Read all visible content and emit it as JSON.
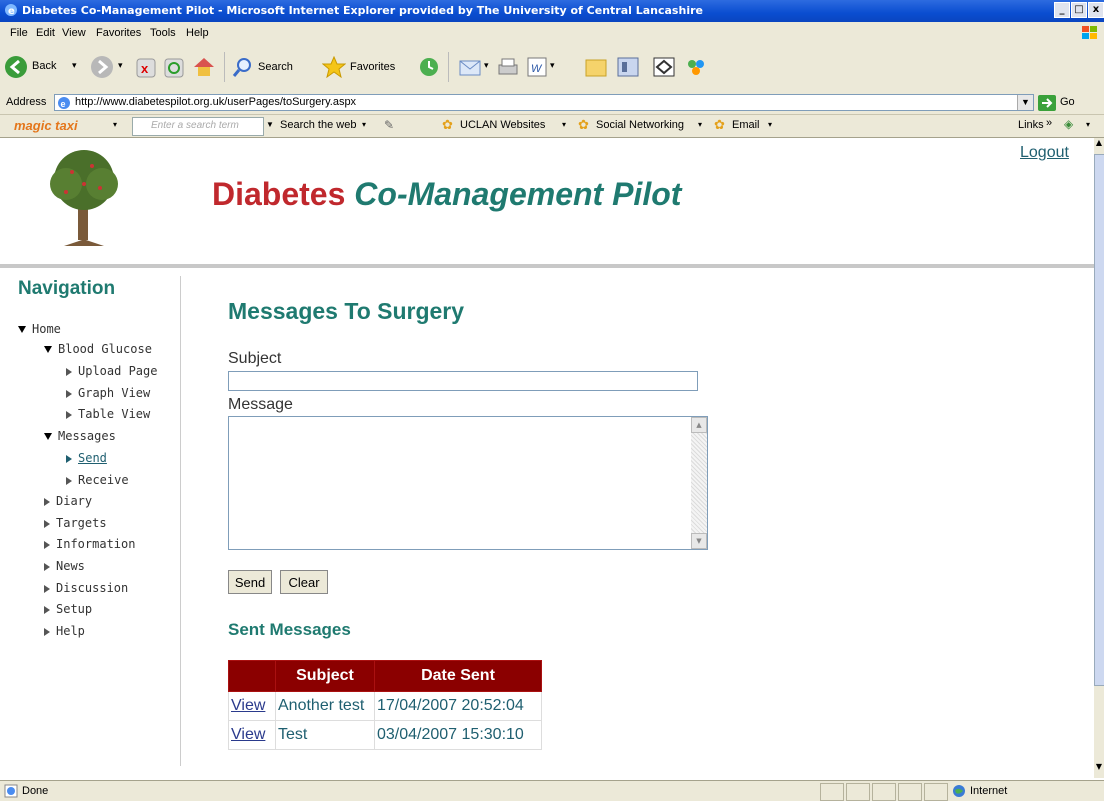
{
  "window": {
    "title": "Diabetes Co-Management Pilot - Microsoft Internet Explorer provided by The University of Central Lancashire",
    "controls": [
      "_",
      "□",
      "x"
    ]
  },
  "menu": [
    "File",
    "Edit",
    "View",
    "Favorites",
    "Tools",
    "Help"
  ],
  "toolbar": {
    "back_label": "Back",
    "search_label": "Search",
    "favorites_label": "Favorites"
  },
  "address": {
    "label": "Address",
    "url": "http://www.diabetespilot.org.uk/userPages/toSurgery.aspx",
    "go_label": "Go"
  },
  "linksbar": {
    "brand": "magic taxi",
    "search_placeholder": "Enter a search term",
    "search_web": "Search the web",
    "items": [
      "UCLAN Websites",
      "Social Networking",
      "Email"
    ],
    "links_label": "Links"
  },
  "site": {
    "title_part1": "Diabetes",
    "title_part2": "Co-Management Pilot",
    "logout": "Logout",
    "colors": {
      "accent": "#1f7a70",
      "brand_red": "#c0282d",
      "table_header": "#8b0000"
    }
  },
  "nav": {
    "heading": "Navigation",
    "items": [
      {
        "label": "Home",
        "state": "expanded"
      },
      {
        "label": "Blood Glucose",
        "state": "expanded"
      },
      {
        "label": "Upload Page",
        "state": "collapsed"
      },
      {
        "label": "Graph View",
        "state": "collapsed"
      },
      {
        "label": "Table View",
        "state": "collapsed"
      },
      {
        "label": "Messages",
        "state": "expanded"
      },
      {
        "label": "Send",
        "state": "collapsed",
        "active": true
      },
      {
        "label": "Receive",
        "state": "collapsed"
      },
      {
        "label": "Diary",
        "state": "collapsed"
      },
      {
        "label": "Targets",
        "state": "collapsed"
      },
      {
        "label": "Information",
        "state": "collapsed"
      },
      {
        "label": "News",
        "state": "collapsed"
      },
      {
        "label": "Discussion",
        "state": "collapsed"
      },
      {
        "label": "Setup",
        "state": "collapsed"
      },
      {
        "label": "Help",
        "state": "collapsed"
      }
    ]
  },
  "main": {
    "heading": "Messages To Surgery",
    "subject_label": "Subject",
    "subject_value": "",
    "message_label": "Message",
    "message_value": "",
    "send_button": "Send",
    "clear_button": "Clear",
    "sent_heading": "Sent Messages",
    "table": {
      "headers": [
        "",
        "Subject",
        "Date Sent"
      ],
      "rows": [
        {
          "action": "View",
          "subject": "Another test",
          "date": "17/04/2007 20:52:04"
        },
        {
          "action": "View",
          "subject": "Test",
          "date": "03/04/2007 15:30:10"
        }
      ]
    }
  },
  "status": {
    "text": "Done",
    "zone": "Internet"
  }
}
